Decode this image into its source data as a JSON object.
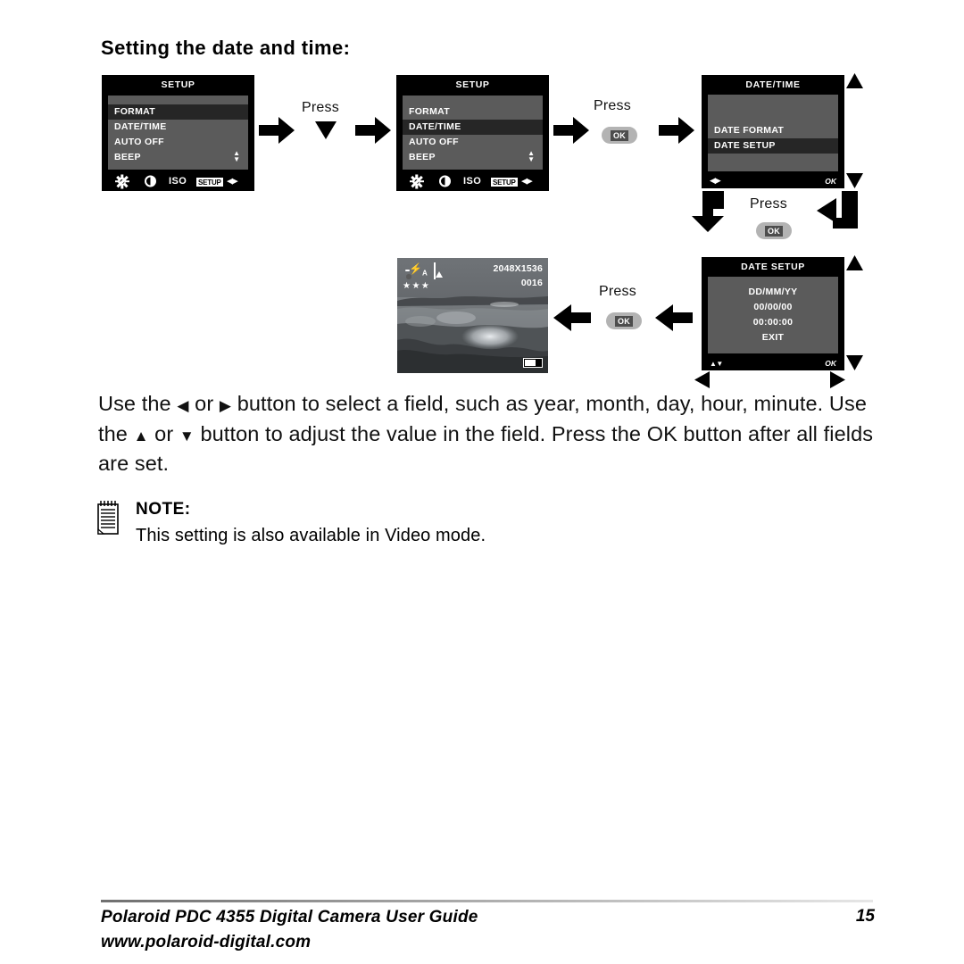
{
  "heading": "Setting the date and time:",
  "screens": {
    "setup1": {
      "title": "SETUP",
      "items": [
        "FORMAT",
        "DATE/TIME",
        "AUTO OFF",
        "BEEP"
      ],
      "selected": "FORMAT",
      "iconbar": [
        "sun-icon",
        "contrast-icon",
        "ISO",
        "SETUP",
        "left-right-icon"
      ],
      "iso_label": "ISO",
      "setup_label": "SETUP",
      "scroll_indicator": "up-down-icon"
    },
    "setup2": {
      "title": "SETUP",
      "items": [
        "FORMAT",
        "DATE/TIME",
        "AUTO OFF",
        "BEEP"
      ],
      "selected": "DATE/TIME",
      "iso_label": "ISO",
      "setup_label": "SETUP",
      "scroll_indicator": "up-down-icon"
    },
    "datetime": {
      "title": "DATE/TIME",
      "items": [
        "DATE FORMAT",
        "DATE SETUP"
      ],
      "selected": "DATE SETUP",
      "hint_left": "left-right-icon",
      "hint_right": "OK"
    },
    "datesetup": {
      "title": "DATE SETUP",
      "rows": [
        "DD/MM/YY",
        "00/00/00",
        "00:00:00",
        "EXIT"
      ],
      "hint_left": "up-down-icon",
      "hint_right": "OK"
    },
    "preview": {
      "resolution": "2048X1536",
      "count": "0016",
      "quality": "★★★",
      "mode_icon": "camera-icon",
      "flash_icon": "flash-auto-icon",
      "flash_label": "A",
      "scene_icon": "portrait-icon",
      "battery_icon": "battery-icon"
    }
  },
  "steps": {
    "press1_label": "Press",
    "press1_key": "down-arrow-icon",
    "press2_label": "Press",
    "press2_key": "OK",
    "press3_label": "Press",
    "press3_key": "OK",
    "press4_label": "Press",
    "press4_key": "OK"
  },
  "body": {
    "paragraph_parts": {
      "p1": "Use the ",
      "left_tri": "◀",
      "p2": " or ",
      "right_tri": "▶",
      "p3": " button to select a field, such as year, month, day, hour, minute. Use the ",
      "up_tri": "▲",
      "p4": " or ",
      "down_tri": "▼",
      "p5": " button to adjust the value in the field. Press the OK button after all fields are set."
    },
    "note_label": "NOTE:",
    "note_text": "This setting is also available in Video mode.",
    "note_icon": "notepad-icon"
  },
  "footer": {
    "line1": "Polaroid PDC 4355 Digital Camera User Guide",
    "line2": "www.polaroid-digital.com",
    "page_number": "15"
  },
  "colors": {
    "screen_bg": "#000000",
    "panel_bg": "#5b5b5b",
    "highlight": "#262626",
    "text": "#ffffff",
    "ok_button": "#b3b3b3"
  }
}
